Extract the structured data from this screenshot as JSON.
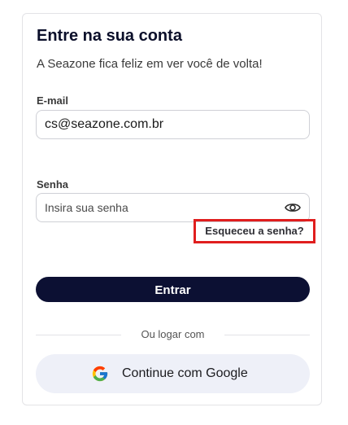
{
  "login": {
    "title": "Entre na sua conta",
    "subtitle": "A Seazone fica feliz em ver você de volta!",
    "email": {
      "label": "E-mail",
      "value": "cs@seazone.com.br"
    },
    "password": {
      "label": "Senha",
      "placeholder": "Insira sua senha",
      "toggle_icon": "eye-icon"
    },
    "forgot_label": "Esqueceu a senha?",
    "submit_label": "Entrar",
    "divider_text": "Ou logar com",
    "google": {
      "icon": "google-icon",
      "label": "Continue com Google"
    }
  },
  "colors": {
    "primary": "#0c1033",
    "highlight_border": "#e01e1e",
    "google_button_bg": "#eef0f8"
  }
}
